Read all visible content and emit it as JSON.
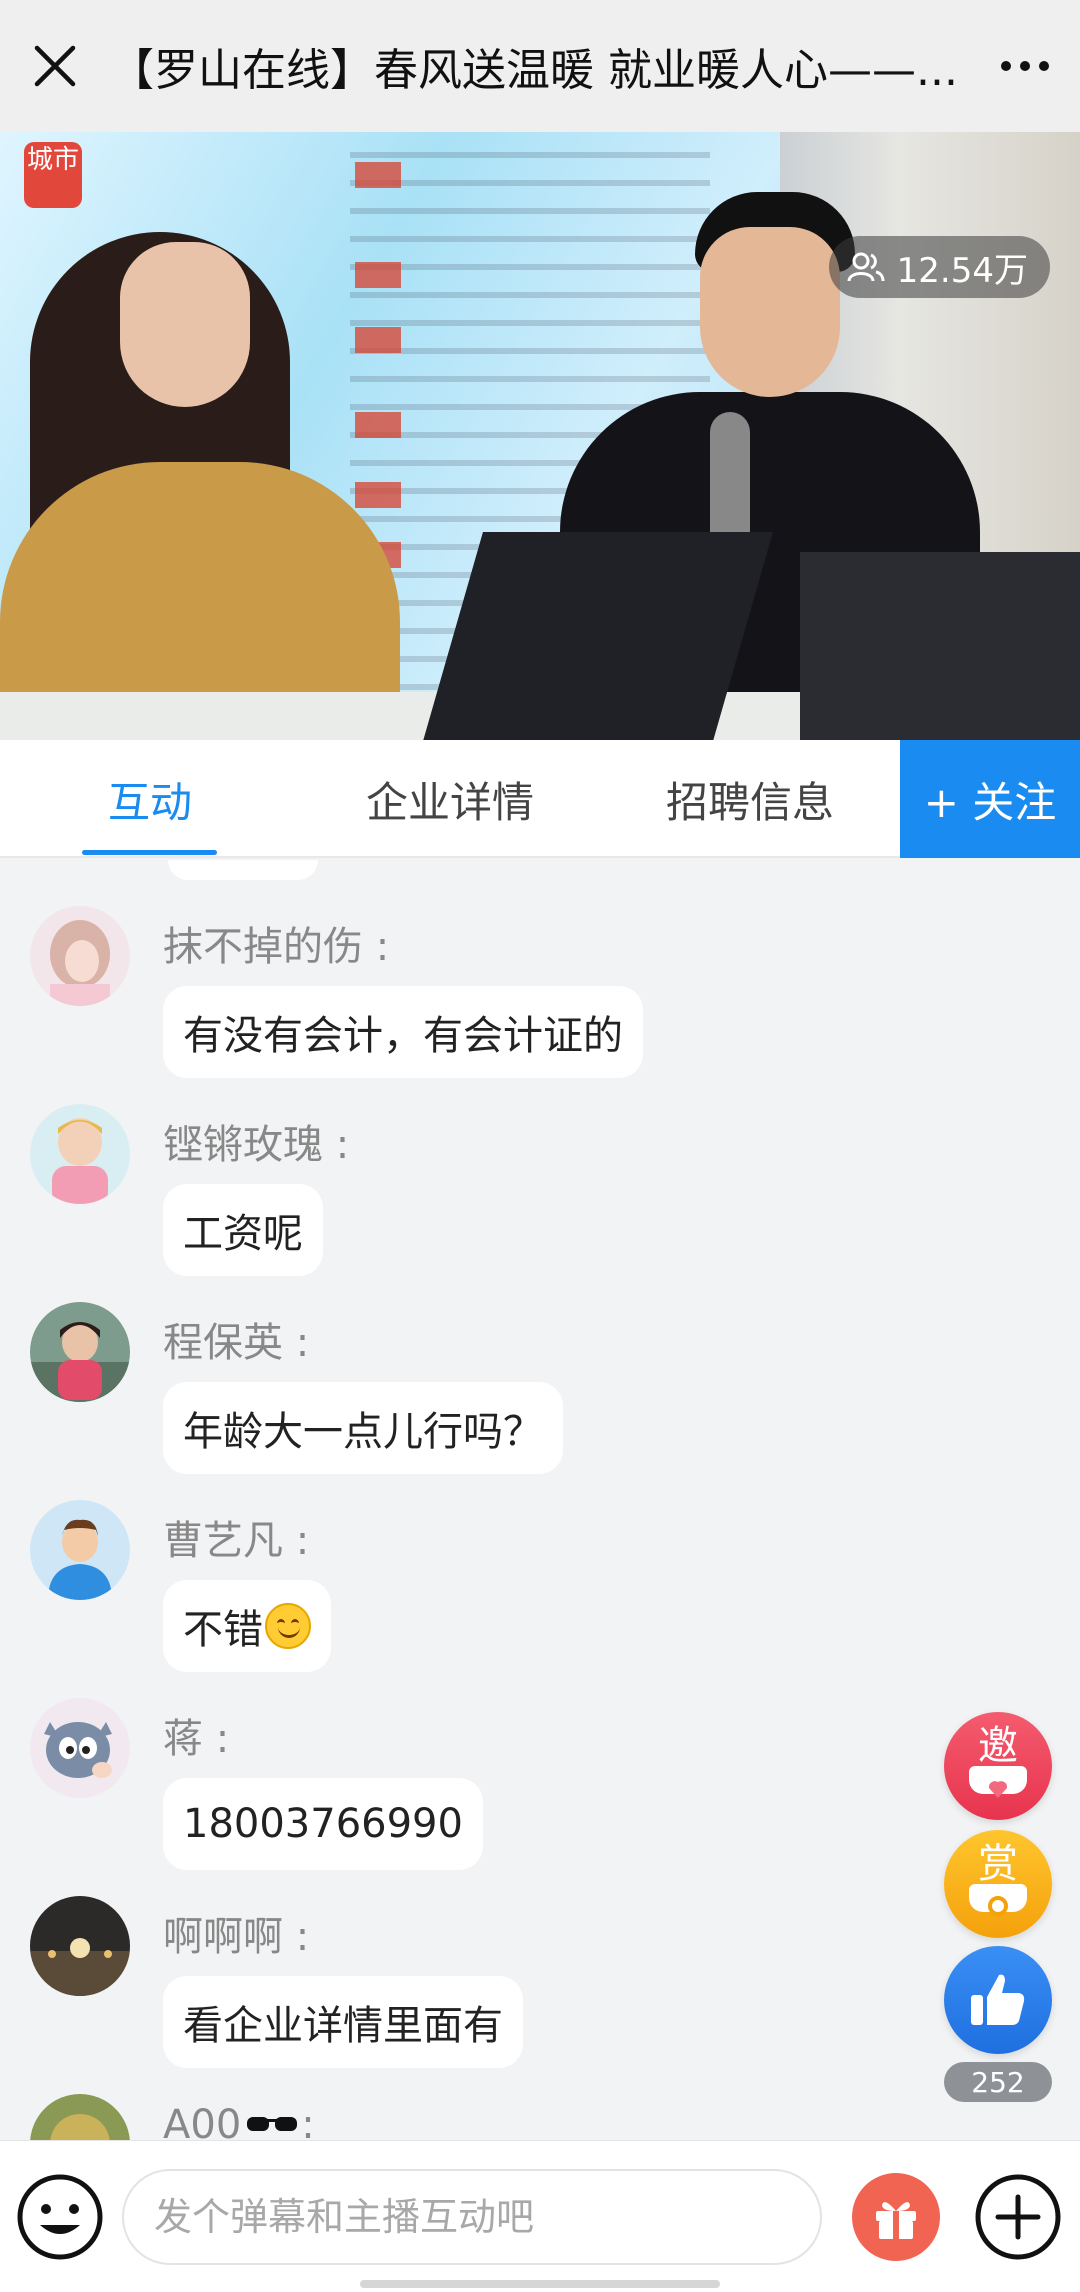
{
  "header": {
    "title": "【罗山在线】春风送温暖 就业暖人心——...",
    "close_icon": "close-icon",
    "more_icon": "more-icon"
  },
  "video": {
    "logo_text": "城市",
    "viewer_count": "12.54万",
    "viewer_icon": "users-icon"
  },
  "tabs": {
    "items": [
      {
        "label": "互动",
        "active": true
      },
      {
        "label": "企业详情",
        "active": false
      },
      {
        "label": "招聘信息",
        "active": false
      }
    ],
    "follow_label": "+ 关注",
    "accent_color": "#1a8bf0"
  },
  "chat": {
    "messages": [
      {
        "user": "抹不掉的伤 :",
        "text": "有没有会计，有会计证的"
      },
      {
        "user": "铿锵玫瑰 :",
        "text": "工资呢"
      },
      {
        "user": "程保英 :",
        "text": "年龄大一点儿行吗？"
      },
      {
        "user": "曹艺凡 :",
        "text": "不错",
        "emoji": "smile-emoji"
      },
      {
        "user": "蒋 :",
        "text": "18003766990"
      },
      {
        "user": "啊啊啊 :",
        "text": "看企业详情里面有"
      },
      {
        "user": "A00",
        "user_suffix_icon": "sunglasses-icon",
        "user_colon": " :"
      }
    ]
  },
  "floating": {
    "invite_label": "邀",
    "reward_label": "赏",
    "like_icon": "thumbs-up-icon",
    "like_count": "252"
  },
  "bottom": {
    "input_placeholder": "发个弹幕和主播互动吧",
    "emoji_icon": "emoji-icon",
    "gift_icon": "gift-icon",
    "plus_icon": "plus-icon"
  }
}
